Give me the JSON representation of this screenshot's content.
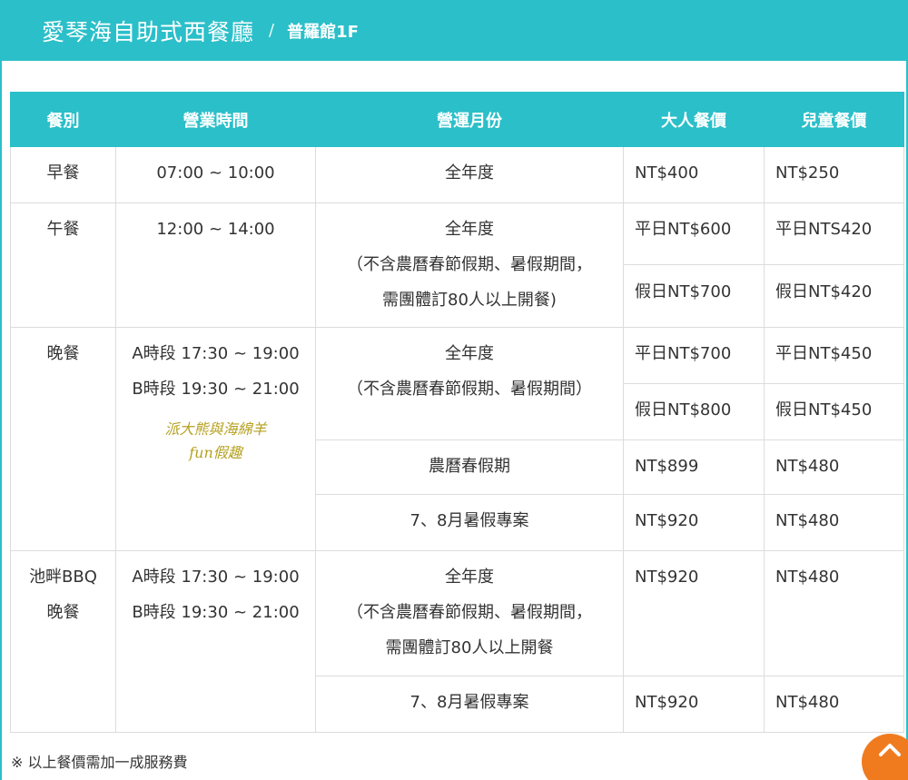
{
  "header": {
    "title": "愛琴海自助式西餐廳",
    "separator": "/",
    "subtitle": "普羅館1F"
  },
  "table": {
    "headers": [
      "餐別",
      "營業時間",
      "營運月份",
      "大人餐價",
      "兒童餐價"
    ],
    "breakfast": {
      "meal": "早餐",
      "hours": "07:00 ~ 10:00",
      "period": "全年度",
      "adult": "NT$400",
      "child": "NT$250"
    },
    "lunch": {
      "meal": "午餐",
      "hours": "12:00 ~ 14:00",
      "period_lines": [
        "全年度",
        "（不含農曆春節假期、暑假期間，",
        "需團體訂80人以上開餐)"
      ],
      "adult_weekday": "平日NT$600",
      "child_weekday": "平日NTS420",
      "adult_holiday": "假日NT$700",
      "child_holiday": "假日NT$420"
    },
    "dinner": {
      "meal": "晚餐",
      "hours_a": "A時段 17:30 ~ 19:00",
      "hours_b": "B時段 19:30 ~ 21:00",
      "watermark_line1": "派大熊與海綿羊",
      "watermark_line2": "fun假趣",
      "period_lines": [
        "全年度",
        "（不含農曆春節假期、暑假期間）"
      ],
      "adult_weekday": "平日NT$700",
      "child_weekday": "平日NT$450",
      "adult_holiday": "假日NT$800",
      "child_holiday": "假日NT$450",
      "new_year_period": "農曆春假期",
      "new_year_adult": "NT$899",
      "new_year_child": "NT$480",
      "summer_period": "7、8月暑假專案",
      "summer_adult": "NT$920",
      "summer_child": "NT$480"
    },
    "bbq": {
      "meal_line1": "池畔BBQ",
      "meal_line2": "晚餐",
      "hours_a": "A時段 17:30 ~ 19:00",
      "hours_b": "B時段 19:30 ~ 21:00",
      "period_lines": [
        "全年度",
        "（不含農曆春節假期、暑假期間，",
        "需團體訂80人以上開餐"
      ],
      "adult": "NT$920",
      "child": "NT$480",
      "summer_period": "7、8月暑假專案",
      "summer_adult": "NT$920",
      "summer_child": "NT$480"
    }
  },
  "footnote": "※ 以上餐價需加一成服務費",
  "scroll_top": {
    "icon": "chevron-up-icon"
  },
  "colors": {
    "accent": "#2bbfc9",
    "scroll_button": "#f07b1f",
    "watermark": "#b5a11f"
  }
}
